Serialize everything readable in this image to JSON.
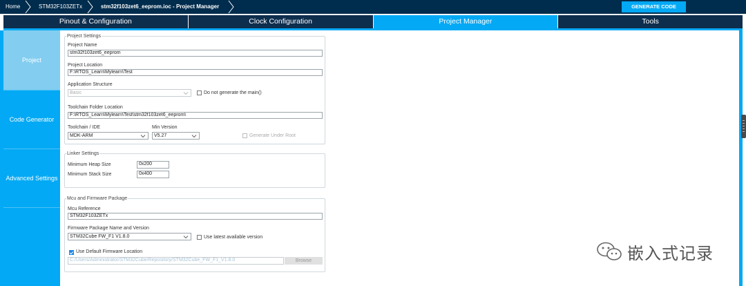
{
  "breadcrumb": {
    "home": "Home",
    "mcu": "STM32F103ZETx",
    "file": "stm32f103zet6_eeprom.ioc - Project Manager"
  },
  "generate_button": "GENERATE CODE",
  "tabs": [
    {
      "label": "Pinout & Configuration"
    },
    {
      "label": "Clock Configuration"
    },
    {
      "label": "Project Manager",
      "active": true
    },
    {
      "label": "Tools"
    }
  ],
  "sidebar": {
    "items": [
      {
        "label": "Project",
        "active": true
      },
      {
        "label": "Code Generator"
      },
      {
        "label": "Advanced Settings"
      }
    ]
  },
  "project_settings": {
    "legend": "Project Settings",
    "project_name_label": "Project Name",
    "project_name": "stm32f103zet6_eeprom",
    "project_location_label": "Project Location",
    "project_location": "F:\\RTOS_Learn\\Mylearn\\Test",
    "app_structure_label": "Application Structure",
    "app_structure": "Basic",
    "no_main_label": "Do not generate the main()",
    "toolchain_folder_label": "Toolchain Folder Location",
    "toolchain_folder": "F:\\RTOS_Learn\\Mylearn\\Test\\stm32f103zet6_eeprom\\",
    "toolchain_ide_label": "Toolchain / IDE",
    "toolchain_ide": "MDK-ARM",
    "min_version_label": "Min Version",
    "min_version": "V5.27",
    "generate_under_root_label": "Generate Under Root"
  },
  "linker_settings": {
    "legend": "Linker Settings",
    "heap_label": "Minimum Heap Size",
    "heap_value": "0x200",
    "stack_label": "Minimum Stack Size",
    "stack_value": "0x400"
  },
  "firmware": {
    "legend": "Mcu and Firmware Package",
    "mcu_ref_label": "Mcu Reference",
    "mcu_ref": "STM32F103ZETx",
    "fw_name_label": "Firmware Package Name and Version",
    "fw_name": "STM32Cube FW_F1 V1.8.0",
    "use_latest_label": "Use latest available version",
    "use_default_label": "Use Default Firmware Location",
    "fw_location": "C:/Users/Administrator/STM32Cube/Repository/STM32Cube_FW_F1_V1.8.0",
    "browse_label": "Browse"
  },
  "watermark": "嵌入式记录",
  "colors": {
    "navy": "#002c4d",
    "accent": "#03a9f4"
  }
}
